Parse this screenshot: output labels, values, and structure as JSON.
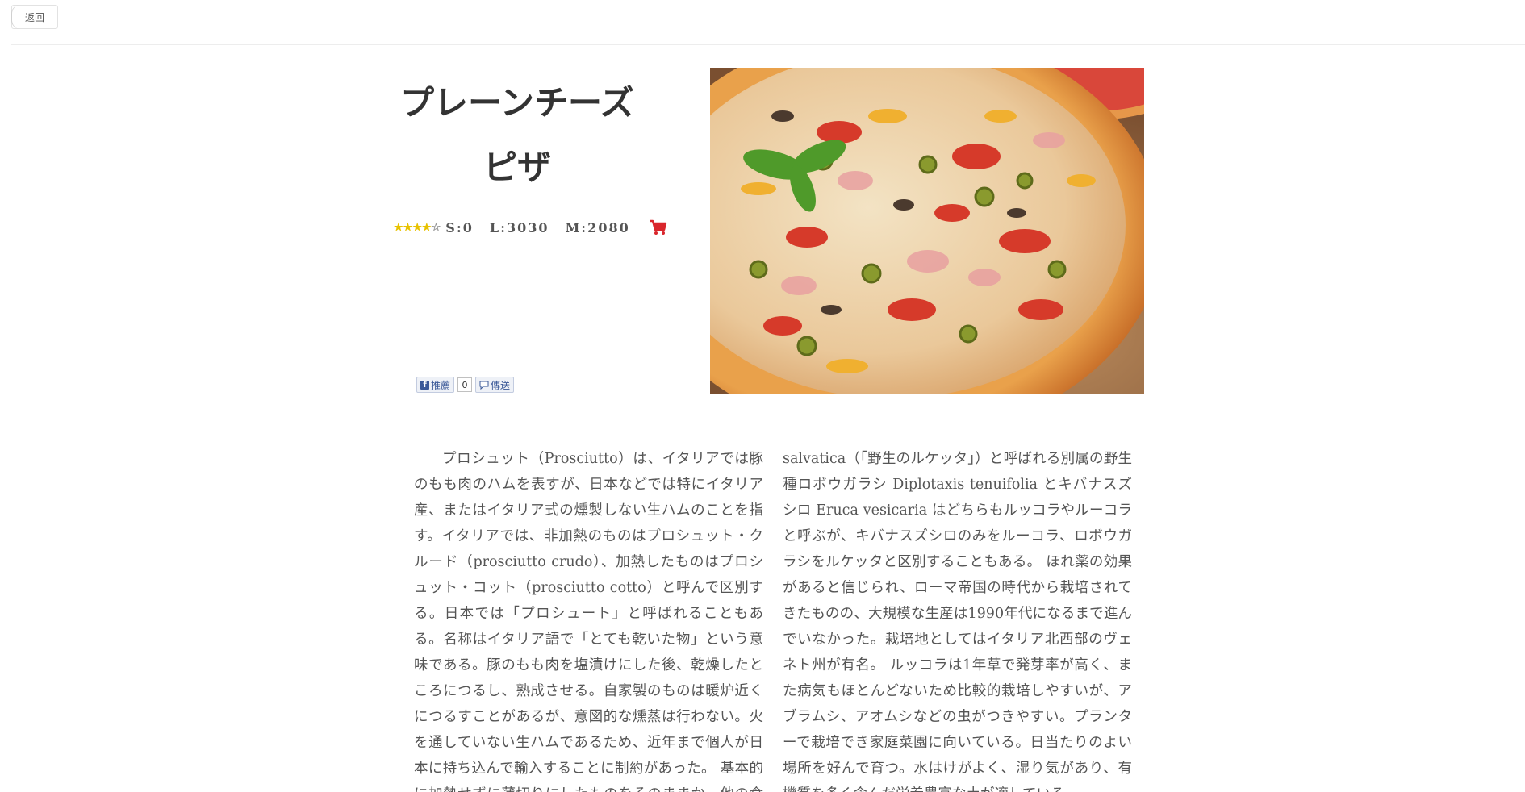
{
  "header": {
    "back_label": "返回"
  },
  "product": {
    "title_line1": "プレーンチーズ",
    "title_line2": "ピザ",
    "rating": {
      "value": 4,
      "max": 5
    },
    "prices": [
      {
        "label": "S:0"
      },
      {
        "label": "L:3030"
      },
      {
        "label": "M:2080"
      }
    ]
  },
  "share": {
    "like_label": "推薦",
    "like_count": "0",
    "send_label": "傳送"
  },
  "article": {
    "col1": "プロシュット（Prosciutto）は、イタリアでは豚のもも肉のハムを表すが、日本などでは特にイタリア産、またはイタリア式の燻製しない生ハムのことを指す。イタリアでは、非加熱のものはプロシュット・クルード（prosciutto crudo）、加熱したものはプロシュット・コット（prosciutto cotto）と呼んで区別する。日本では「プロシュート」と呼ばれることもある。名称はイタリア語で「とても乾いた物」という意味である。豚のもも肉を塩漬けにした後、乾燥したところにつるし、熟成させる。自家製のものは暖炉近くにつるすことがあるが、意図的な燻蒸は行わない。火を通していない生ハムであるため、近年まで個人が日本に持ち込んで輸入することに制約があった。 基本的に加熱せずに薄切りにしたものをそのままか、他の食材に",
    "col2": "salvatica（「野生のルケッタ」）と呼ばれる別属の野生種ロボウガラシ Diplotaxis tenuifolia とキバナスズシロ Eruca vesicaria はどちらもルッコラやルーコラと呼ぶが、キバナスズシロのみをルーコラ、ロボウガラシをルケッタと区別することもある。 ほれ薬の効果があると信じられ、ローマ帝国の時代から栽培されてきたものの、大規模な生産は1990年代になるまで進んでいなかった。栽培地としてはイタリア北西部のヴェネト州が有名。 ルッコラは1年草で発芽率が高く、また病気もほとんどないため比較的栽培しやすいが、アブラムシ、アオムシなどの虫がつきやすい。プランターで栽培でき家庭菜園に向いている。日当たりのよい場所を好んで育つ。水はけがよく、湿り気があり、有機質を多く含んだ栄養豊富な土が適している。"
  },
  "colors": {
    "cart": "#d9262c",
    "star": "#e8c200",
    "facebook": "#3b5998"
  }
}
